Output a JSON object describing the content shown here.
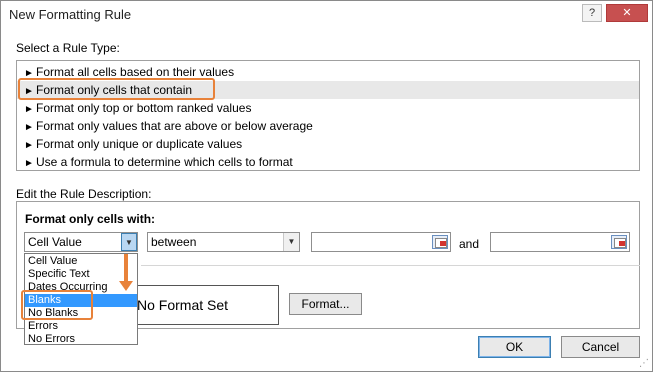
{
  "window": {
    "title": "New Formatting Rule",
    "help_button": "?",
    "close_button": "✕"
  },
  "rule_type": {
    "label": "Select a Rule Type:",
    "items": [
      {
        "label": "Format all cells based on their values"
      },
      {
        "label": "Format only cells that contain"
      },
      {
        "label": "Format only top or bottom ranked values"
      },
      {
        "label": "Format only values that are above or below average"
      },
      {
        "label": "Format only unique or duplicate values"
      },
      {
        "label": "Use a formula to determine which cells to format"
      }
    ],
    "selected_index": 1,
    "arrow_glyph": "►"
  },
  "rule_description": {
    "label": "Edit the Rule Description:",
    "format_only_cells_with": "Format only cells with:",
    "condition_combo": {
      "value": "Cell Value"
    },
    "operator_combo": {
      "value": "between"
    },
    "value1": "",
    "and_label": "and",
    "value2": "",
    "dropdown_options": [
      "Cell Value",
      "Specific Text",
      "Dates Occurring",
      "Blanks",
      "No Blanks",
      "Errors",
      "No Errors"
    ],
    "dropdown_selected": "Blanks",
    "preview_text": "No Format Set",
    "format_button": "Format..."
  },
  "footer": {
    "ok_button": "OK",
    "cancel_button": "Cancel"
  },
  "colors": {
    "highlight": "#e8823a",
    "selection_blue": "#3399ff",
    "close_red": "#c75050"
  }
}
